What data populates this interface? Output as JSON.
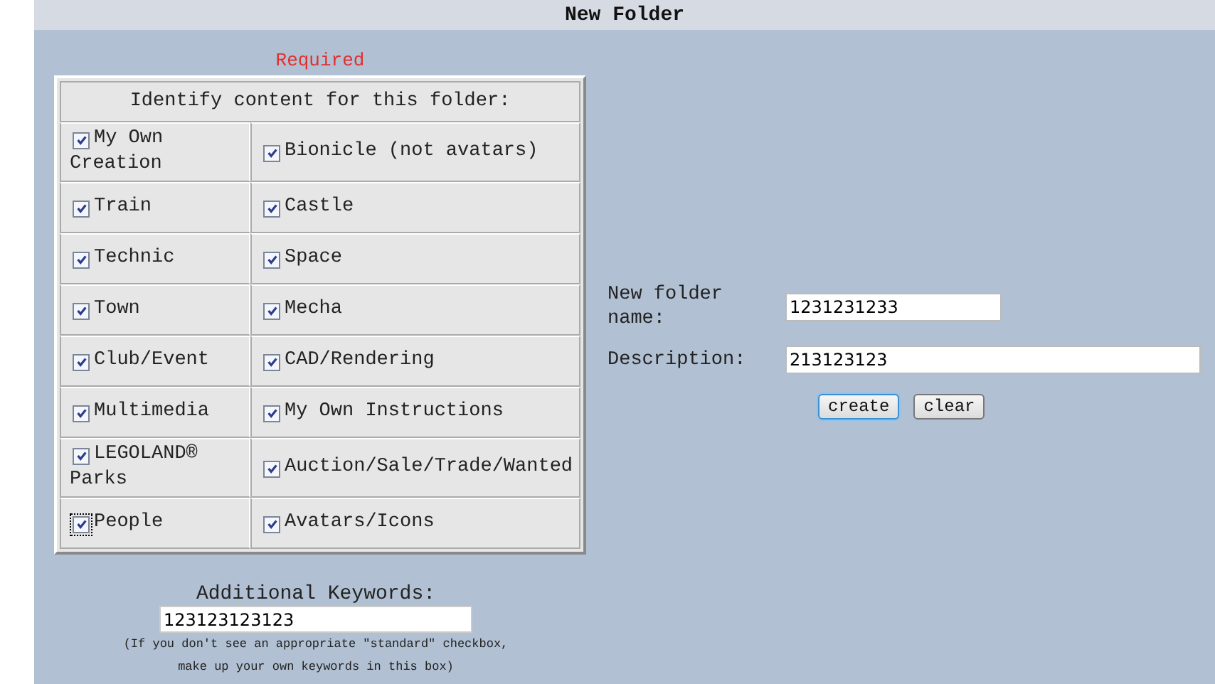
{
  "header": {
    "title": "New Folder"
  },
  "required_label": "Required",
  "content_table": {
    "heading": "Identify content for this folder:",
    "items": [
      {
        "label": "My Own Creation",
        "checked": true,
        "focused": false
      },
      {
        "label": "Bionicle (not avatars)",
        "checked": true,
        "focused": false
      },
      {
        "label": "Train",
        "checked": true,
        "focused": false
      },
      {
        "label": "Castle",
        "checked": true,
        "focused": false
      },
      {
        "label": "Technic",
        "checked": true,
        "focused": false
      },
      {
        "label": "Space",
        "checked": true,
        "focused": false
      },
      {
        "label": "Town",
        "checked": true,
        "focused": false
      },
      {
        "label": "Mecha",
        "checked": true,
        "focused": false
      },
      {
        "label": "Club/Event",
        "checked": true,
        "focused": false
      },
      {
        "label": "CAD/Rendering",
        "checked": true,
        "focused": false
      },
      {
        "label": "Multimedia",
        "checked": true,
        "focused": false
      },
      {
        "label": "My Own Instructions",
        "checked": true,
        "focused": false
      },
      {
        "label": "LEGOLAND® Parks",
        "checked": true,
        "focused": false
      },
      {
        "label": "Auction/Sale/Trade/Wanted",
        "checked": true,
        "focused": false
      },
      {
        "label": "People",
        "checked": true,
        "focused": true
      },
      {
        "label": "Avatars/Icons",
        "checked": true,
        "focused": false
      }
    ]
  },
  "keywords": {
    "label": "Additional Keywords:",
    "value": "123123123123",
    "note": "(If you don't see an appropriate \"standard\" checkbox,\nmake up your own keywords in this box)"
  },
  "form": {
    "name_label": "New folder name:",
    "name_value": "1231231233",
    "description_label": "Description:",
    "description_value": "213123123"
  },
  "buttons": [
    {
      "label": "create",
      "focused": true
    },
    {
      "label": "clear",
      "focused": false
    }
  ]
}
